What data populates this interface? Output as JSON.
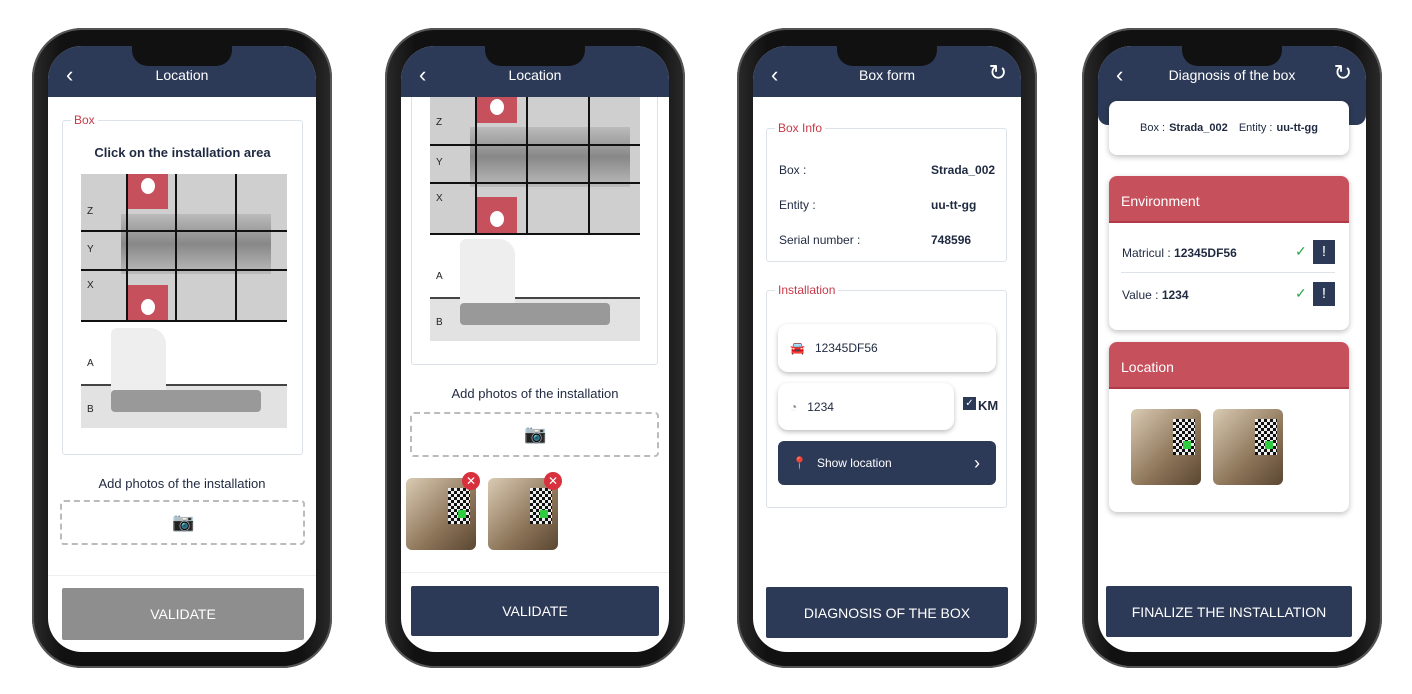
{
  "colors": {
    "header": "#2c3a57",
    "accent": "#c6515c",
    "disabled": "#8e8e8e",
    "check": "#2aa84a"
  },
  "screen1": {
    "title": "Location",
    "box_legend": "Box",
    "instruction": "Click on the installation area",
    "grid_labels": [
      "Z",
      "Y",
      "X"
    ],
    "side_labels": [
      "A",
      "B"
    ],
    "photos_label": "Add photos of the installation",
    "validate": "VALIDATE"
  },
  "screen2": {
    "title": "Location",
    "grid_labels": [
      "Z",
      "Y",
      "X"
    ],
    "side_labels": [
      "A",
      "B"
    ],
    "photos_label": "Add photos of the installation",
    "validate": "VALIDATE"
  },
  "screen3": {
    "title": "Box form",
    "box_info_legend": "Box Info",
    "rows": [
      {
        "label": "Box :",
        "value": "Strada_002"
      },
      {
        "label": "Entity :",
        "value": "uu-tt-gg"
      },
      {
        "label": "Serial number :",
        "value": "748596"
      }
    ],
    "installation_legend": "Installation",
    "plate_value": "12345DF56",
    "km_value": "1234",
    "km_label": "KM",
    "km_checked": true,
    "show_location": "Show location",
    "diagnosis": "DIAGNOSIS OF THE BOX"
  },
  "screen4": {
    "title": "Diagnosis of the box",
    "box_label": "Box :",
    "box_value": "Strada_002",
    "entity_label": "Entity :",
    "entity_value": "uu-tt-gg",
    "environment": "Environment",
    "rows": [
      {
        "label": "Matricul :",
        "value": "12345DF56"
      },
      {
        "label": "Value :",
        "value": "1234"
      }
    ],
    "location": "Location",
    "finalize": "FINALIZE THE INSTALLATION"
  }
}
